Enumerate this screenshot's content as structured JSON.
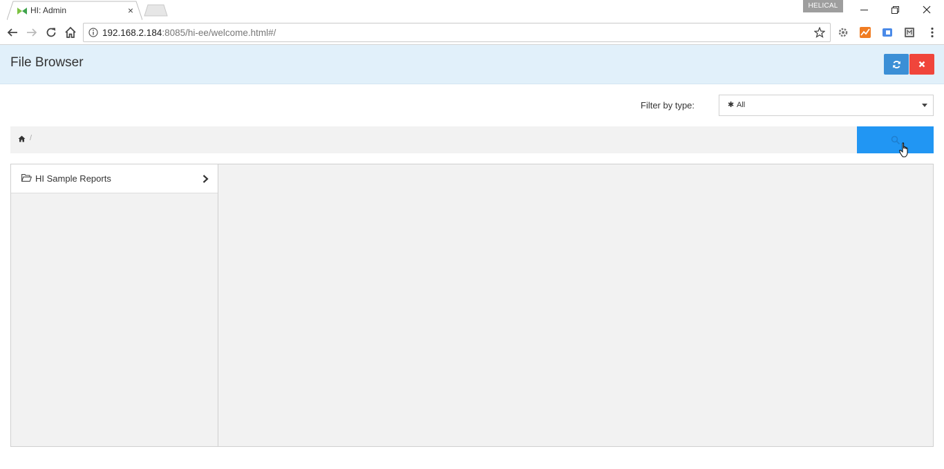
{
  "browser": {
    "tab_title": "HI: Admin",
    "profile_name": "HELICAL",
    "url_host": "192.168.2.184",
    "url_rest": ":8085/hi-ee/welcome.html#/"
  },
  "header": {
    "title": "File Browser"
  },
  "filter": {
    "label": "Filter by type:",
    "selected_value": "All"
  },
  "breadcrumb": {
    "separator": "/"
  },
  "folders": [
    {
      "label": "HI Sample Reports"
    }
  ],
  "colors": {
    "header_bg": "#e1f0fa",
    "refresh_button": "#3b8fd6",
    "close_button": "#f0453b",
    "search_button": "#2196f3",
    "panel_bg": "#f2f2f2"
  },
  "icons": {
    "home": "home-icon",
    "refresh": "refresh-icon",
    "close": "close-icon",
    "search": "search-icon",
    "folder": "folder-open-icon",
    "chevron": "chevron-right-icon"
  }
}
